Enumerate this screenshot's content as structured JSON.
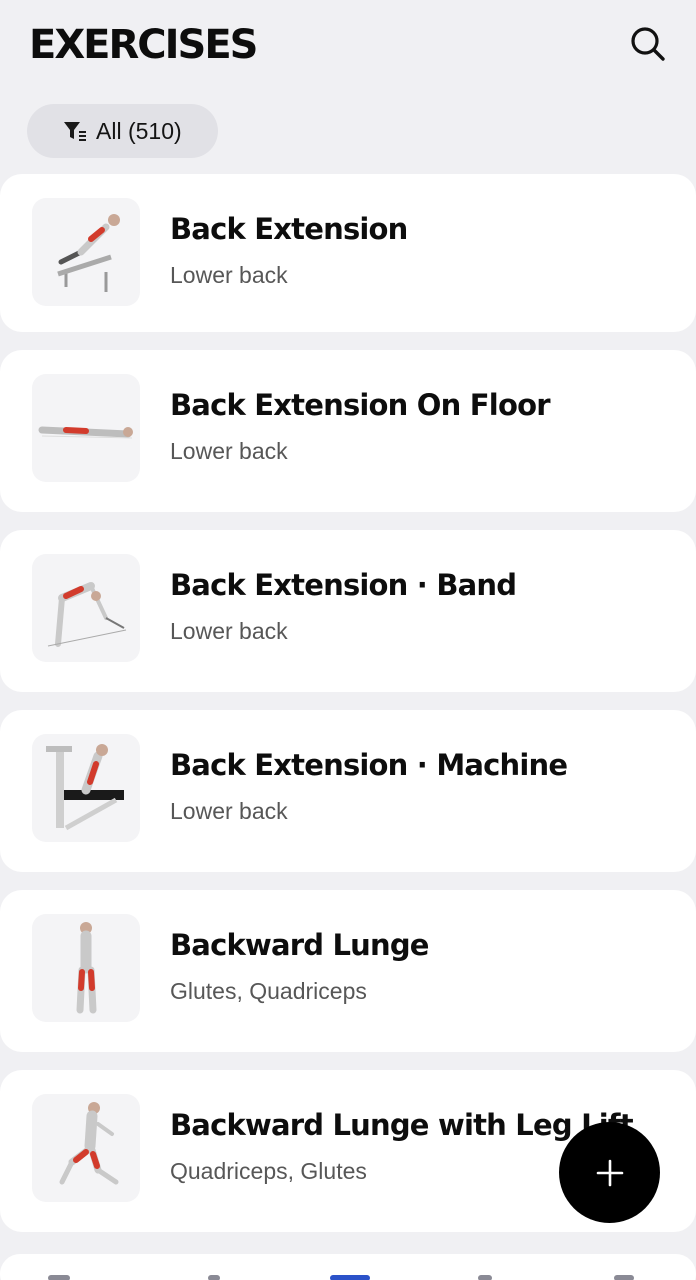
{
  "header": {
    "title": "EXERCISES",
    "search_icon": "search-icon"
  },
  "filter": {
    "label": "All (510)",
    "icon": "filter-icon"
  },
  "exercises": [
    {
      "name": "Back Extension",
      "muscles": "Lower back"
    },
    {
      "name": "Back Extension On Floor",
      "muscles": "Lower back"
    },
    {
      "name": "Back Extension · Band",
      "muscles": "Lower back"
    },
    {
      "name": "Back Extension · Machine",
      "muscles": "Lower back"
    },
    {
      "name": "Backward Lunge",
      "muscles": "Glutes, Quadriceps"
    },
    {
      "name": "Backward Lunge with Leg Lift",
      "muscles": "Quadriceps, Glutes"
    }
  ],
  "fab": {
    "icon": "plus-icon"
  },
  "colors": {
    "background": "#f0f0f3",
    "card": "#ffffff",
    "chip": "#e1e1e6",
    "muscle_highlight": "#d23b2c",
    "fab": "#000000"
  }
}
